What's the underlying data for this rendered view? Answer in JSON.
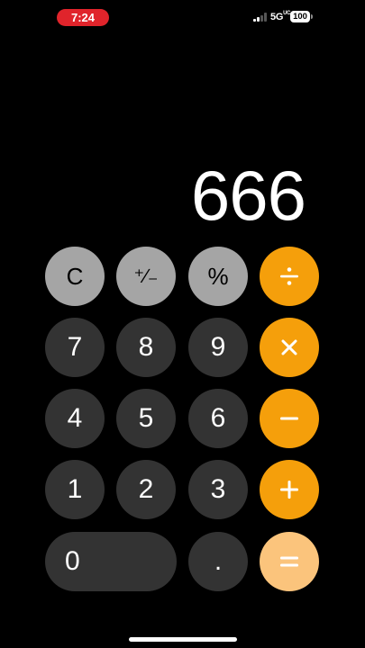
{
  "status_bar": {
    "time": "7:24",
    "network": "5G",
    "network_superscript": "UC",
    "battery": "100"
  },
  "display": {
    "value": "666"
  },
  "keys": {
    "clear": "C",
    "sign": "⁺∕₋",
    "percent": "%",
    "seven": "7",
    "eight": "8",
    "nine": "9",
    "four": "4",
    "five": "5",
    "six": "6",
    "one": "1",
    "two": "2",
    "three": "3",
    "zero": "0",
    "decimal": "."
  },
  "operator_icons": {
    "divide": "divide-icon",
    "multiply": "multiply-icon",
    "subtract": "minus-icon",
    "add": "plus-icon",
    "equals": "equals-icon"
  },
  "colors": {
    "function_key": "#a5a5a5",
    "number_key": "#333333",
    "operator_key": "#f59f0b",
    "equals_key_highlight": "#fbc47c",
    "time_pill": "#e0242b"
  }
}
